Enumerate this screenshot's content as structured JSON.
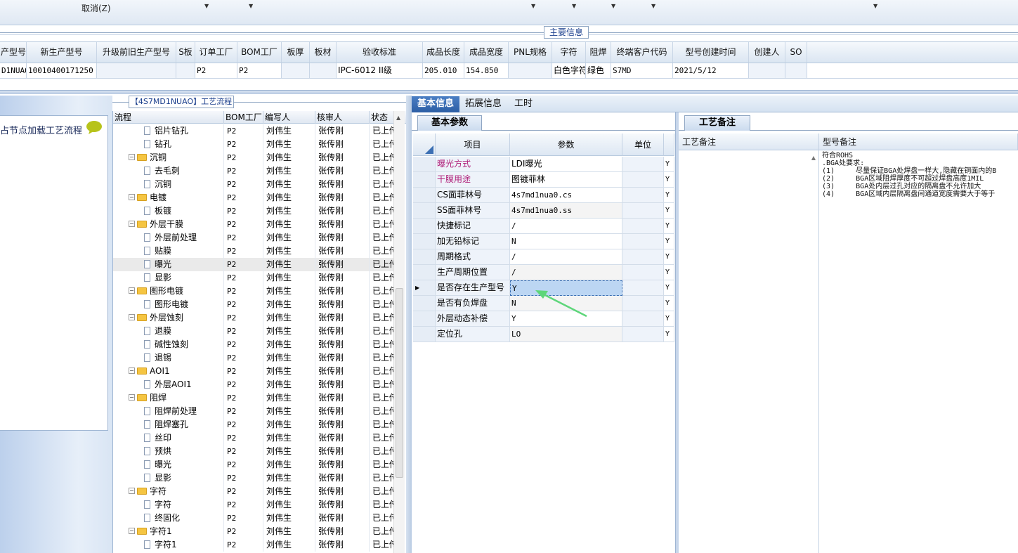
{
  "toolbar": {
    "cancel_label": "取消(Z)"
  },
  "main_info": {
    "label": "主要信息",
    "headers": [
      "产型号",
      "新生产型号",
      "升级前旧生产型号",
      "S板",
      "订单工厂",
      "BOM工厂",
      "板厚",
      "板材",
      "验收标准",
      "成品长度",
      "成品宽度",
      "PNL规格",
      "字符",
      "阻焊",
      "终端客户代码",
      "型号创建时间",
      "创建人",
      "SO"
    ],
    "row": [
      "D1NUAO",
      "10010400171250",
      "",
      "",
      "P2",
      "P2",
      "",
      "",
      "IPC-6012 II级",
      "205.010",
      "154.850",
      "",
      "白色字符",
      "绿色",
      "S7MD",
      "2021/5/12",
      "",
      ""
    ]
  },
  "left_panel": {
    "label": "占节点加载工艺流程",
    "bubble_icon": "speech-bubble-icon"
  },
  "flow": {
    "title": "【4S7MD1NUAO】工艺流程",
    "headers": [
      "流程",
      "BOM工厂",
      "编写人",
      "核审人",
      "状态"
    ],
    "rows": [
      {
        "name": "铝片钻孔",
        "level": 2,
        "bom": "P2",
        "writer": "刘伟生",
        "reviewer": "张传刚",
        "status": "已上传"
      },
      {
        "name": "钻孔",
        "level": 2,
        "bom": "P2",
        "writer": "刘伟生",
        "reviewer": "张传刚",
        "status": "已上传"
      },
      {
        "name": "沉铜",
        "level": 1,
        "bom": "P2",
        "writer": "刘伟生",
        "reviewer": "张传刚",
        "status": "已上传"
      },
      {
        "name": "去毛刺",
        "level": 2,
        "bom": "P2",
        "writer": "刘伟生",
        "reviewer": "张传刚",
        "status": "已上传"
      },
      {
        "name": "沉铜",
        "level": 2,
        "bom": "P2",
        "writer": "刘伟生",
        "reviewer": "张传刚",
        "status": "已上传"
      },
      {
        "name": "电镀",
        "level": 1,
        "bom": "P2",
        "writer": "刘伟生",
        "reviewer": "张传刚",
        "status": "已上传"
      },
      {
        "name": "板镀",
        "level": 2,
        "bom": "P2",
        "writer": "刘伟生",
        "reviewer": "张传刚",
        "status": "已上传"
      },
      {
        "name": "外层干膜",
        "level": 1,
        "bom": "P2",
        "writer": "刘伟生",
        "reviewer": "张传刚",
        "status": "已上传"
      },
      {
        "name": "外层前处理",
        "level": 2,
        "bom": "P2",
        "writer": "刘伟生",
        "reviewer": "张传刚",
        "status": "已上传"
      },
      {
        "name": "贴膜",
        "level": 2,
        "bom": "P2",
        "writer": "刘伟生",
        "reviewer": "张传刚",
        "status": "已上传"
      },
      {
        "name": "曝光",
        "level": 2,
        "bom": "P2",
        "writer": "刘伟生",
        "reviewer": "张传刚",
        "status": "已上传",
        "selected": true
      },
      {
        "name": "显影",
        "level": 2,
        "bom": "P2",
        "writer": "刘伟生",
        "reviewer": "张传刚",
        "status": "已上传"
      },
      {
        "name": "图形电镀",
        "level": 1,
        "bom": "P2",
        "writer": "刘伟生",
        "reviewer": "张传刚",
        "status": "已上传"
      },
      {
        "name": "图形电镀",
        "level": 2,
        "bom": "P2",
        "writer": "刘伟生",
        "reviewer": "张传刚",
        "status": "已上传"
      },
      {
        "name": "外层蚀刻",
        "level": 1,
        "bom": "P2",
        "writer": "刘伟生",
        "reviewer": "张传刚",
        "status": "已上传"
      },
      {
        "name": "退膜",
        "level": 2,
        "bom": "P2",
        "writer": "刘伟生",
        "reviewer": "张传刚",
        "status": "已上传"
      },
      {
        "name": "碱性蚀刻",
        "level": 2,
        "bom": "P2",
        "writer": "刘伟生",
        "reviewer": "张传刚",
        "status": "已上传"
      },
      {
        "name": "退锡",
        "level": 2,
        "bom": "P2",
        "writer": "刘伟生",
        "reviewer": "张传刚",
        "status": "已上传"
      },
      {
        "name": "AOI1",
        "level": 1,
        "bom": "P2",
        "writer": "刘伟生",
        "reviewer": "张传刚",
        "status": "已上传"
      },
      {
        "name": "外层AOI1",
        "level": 2,
        "bom": "P2",
        "writer": "刘伟生",
        "reviewer": "张传刚",
        "status": "已上传"
      },
      {
        "name": "阻焊",
        "level": 1,
        "bom": "P2",
        "writer": "刘伟生",
        "reviewer": "张传刚",
        "status": "已上传"
      },
      {
        "name": "阻焊前处理",
        "level": 2,
        "bom": "P2",
        "writer": "刘伟生",
        "reviewer": "张传刚",
        "status": "已上传"
      },
      {
        "name": "阻焊塞孔",
        "level": 2,
        "bom": "P2",
        "writer": "刘伟生",
        "reviewer": "张传刚",
        "status": "已上传"
      },
      {
        "name": "丝印",
        "level": 2,
        "bom": "P2",
        "writer": "刘伟生",
        "reviewer": "张传刚",
        "status": "已上传"
      },
      {
        "name": "预烘",
        "level": 2,
        "bom": "P2",
        "writer": "刘伟生",
        "reviewer": "张传刚",
        "status": "已上传"
      },
      {
        "name": "曝光",
        "level": 2,
        "bom": "P2",
        "writer": "刘伟生",
        "reviewer": "张传刚",
        "status": "已上传"
      },
      {
        "name": "显影",
        "level": 2,
        "bom": "P2",
        "writer": "刘伟生",
        "reviewer": "张传刚",
        "status": "已上传"
      },
      {
        "name": "字符",
        "level": 1,
        "bom": "P2",
        "writer": "刘伟生",
        "reviewer": "张传刚",
        "status": "已上传"
      },
      {
        "name": "字符",
        "level": 2,
        "bom": "P2",
        "writer": "刘伟生",
        "reviewer": "张传刚",
        "status": "已上传"
      },
      {
        "name": "终固化",
        "level": 2,
        "bom": "P2",
        "writer": "刘伟生",
        "reviewer": "张传刚",
        "status": "已上传"
      },
      {
        "name": "字符1",
        "level": 1,
        "bom": "P2",
        "writer": "刘伟生",
        "reviewer": "张传刚",
        "status": "已上传"
      },
      {
        "name": "字符1",
        "level": 2,
        "bom": "P2",
        "writer": "刘伟生",
        "reviewer": "张传刚",
        "status": "已上传"
      }
    ]
  },
  "tabs": [
    "基本信息",
    "拓展信息",
    "工时"
  ],
  "basic_params": {
    "tab_label": "基本参数",
    "headers": [
      "项目",
      "参数",
      "单位"
    ],
    "rows": [
      {
        "item": "曝光方式",
        "value": "LDI曝光",
        "unit": "",
        "flag": "Y",
        "pink": true
      },
      {
        "item": "干膜用途",
        "value": "图镀菲林",
        "unit": "",
        "flag": "Y",
        "pink": true
      },
      {
        "item": "CS面菲林号",
        "value": "4s7md1nua0.cs",
        "unit": "",
        "flag": "Y"
      },
      {
        "item": "SS面菲林号",
        "value": "4s7md1nua0.ss",
        "unit": "",
        "flag": "Y"
      },
      {
        "item": "快捷标记",
        "value": "/",
        "unit": "",
        "flag": "Y"
      },
      {
        "item": "加无铅标记",
        "value": "N",
        "unit": "",
        "flag": "Y"
      },
      {
        "item": "周期格式",
        "value": "/",
        "unit": "",
        "flag": "Y"
      },
      {
        "item": "生产周期位置",
        "value": "/",
        "unit": "",
        "flag": "Y"
      },
      {
        "item": "是否存在生产型号",
        "value": "Y",
        "unit": "",
        "flag": "Y",
        "selected": true
      },
      {
        "item": "是否有负焊盘",
        "value": "N",
        "unit": "",
        "flag": "Y"
      },
      {
        "item": "外层动态补偿",
        "value": "Y",
        "unit": "",
        "flag": "Y"
      },
      {
        "item": "定位孔",
        "value": "LO",
        "unit": "",
        "flag": "Y"
      }
    ]
  },
  "remarks": {
    "tab_label": "工艺备注",
    "col1_header": "工艺备注",
    "col2_header": "型号备注",
    "model_remark_lines": [
      "符合ROHS",
      ".BGA处要求:",
      "(1)     尽量保证BGA处焊盘一样大,隐藏在铜面内的B",
      "(2)     BGA区域阻焊厚度不可超过焊盘高度1MIL",
      "(3)     BGA处内层过孔对应的隔离盘不允许加大",
      "(4)     BGA区域内层隔离盘间通道宽度需要大于等于"
    ]
  },
  "colors": {
    "accent": "#2c5ea5",
    "pink_text": "#b0207a",
    "arrow": "#5ed67a",
    "folder": "#f5c542"
  }
}
